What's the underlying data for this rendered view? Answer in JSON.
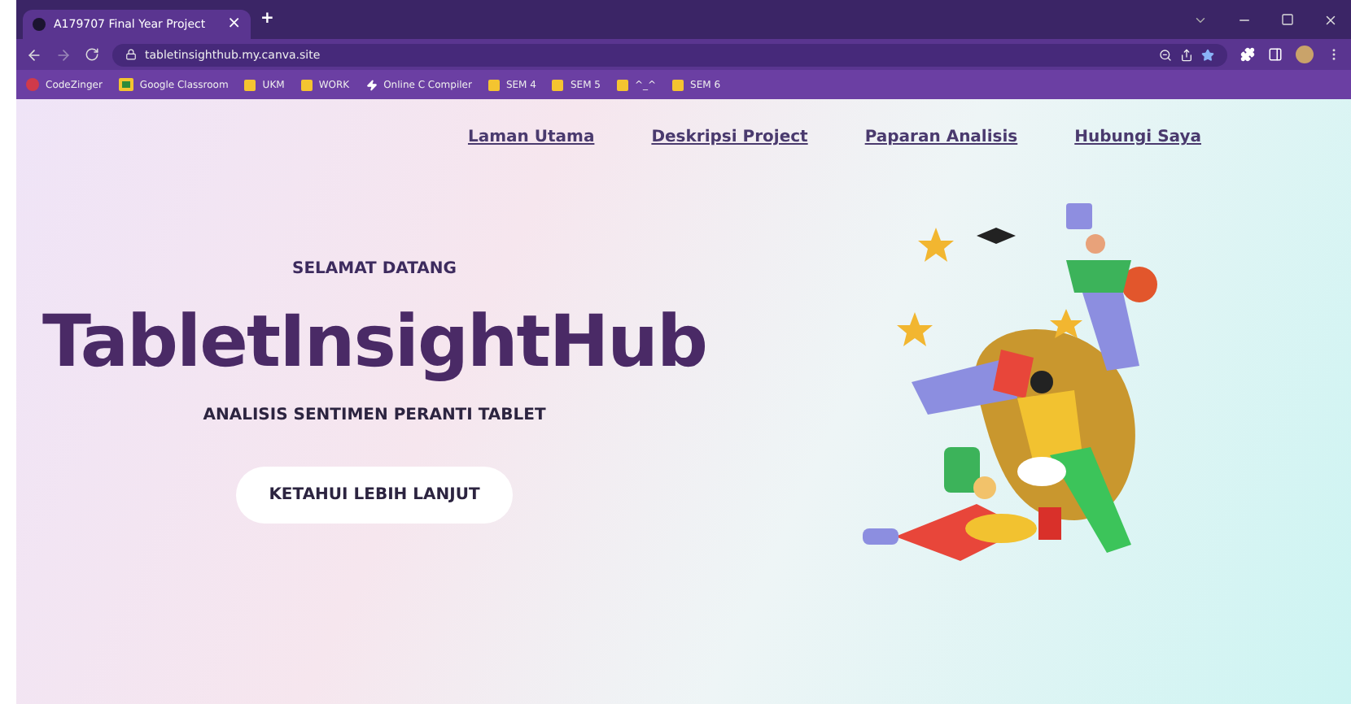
{
  "tab": {
    "title": "A179707 Final Year Project",
    "close": "×",
    "new": "+"
  },
  "address": {
    "url": "tabletinsighthub.my.canva.site"
  },
  "bookmarks": [
    {
      "label": "CodeZinger",
      "kind": "site"
    },
    {
      "label": "Google Classroom",
      "kind": "classroom"
    },
    {
      "label": "UKM",
      "kind": "folder"
    },
    {
      "label": "WORK",
      "kind": "folder"
    },
    {
      "label": "Online C Compiler",
      "kind": "bolt"
    },
    {
      "label": "SEM 4",
      "kind": "folder"
    },
    {
      "label": "SEM 5",
      "kind": "folder"
    },
    {
      "label": "^_^",
      "kind": "folder"
    },
    {
      "label": "SEM 6",
      "kind": "folder"
    }
  ],
  "nav": [
    "Laman Utama",
    "Deskripsi Project",
    "Paparan Analisis",
    "Hubungi Saya"
  ],
  "hero": {
    "greeting": "SELAMAT DATANG",
    "title": "TabletInsightHub",
    "subtitle": "ANALISIS SENTIMEN PERANTI TABLET",
    "button": "KETAHUI LEBIH LANJUT"
  }
}
